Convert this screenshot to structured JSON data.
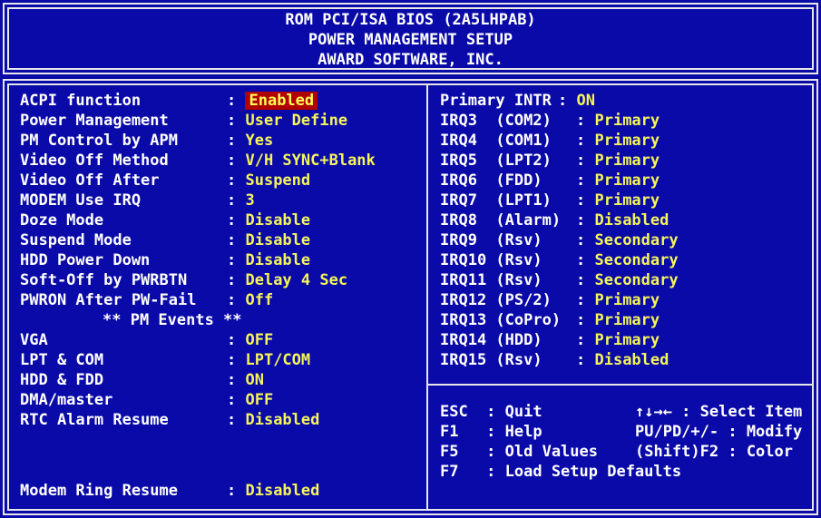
{
  "header": {
    "line1": "ROM PCI/ISA BIOS (2A5LHPAB)",
    "line2": "POWER MANAGEMENT SETUP",
    "line3": "AWARD SOFTWARE, INC."
  },
  "left": [
    {
      "label": "ACPI function",
      "value": "Enabled"
    },
    {
      "label": "Power Management",
      "value": "User Define"
    },
    {
      "label": "PM Control by APM",
      "value": "Yes"
    },
    {
      "label": "Video Off Method",
      "value": "V/H SYNC+Blank"
    },
    {
      "label": "Video Off After",
      "value": "Suspend"
    },
    {
      "label": "MODEM Use IRQ",
      "value": "3"
    },
    {
      "label": "Doze Mode",
      "value": "Disable"
    },
    {
      "label": "Suspend Mode",
      "value": "Disable"
    },
    {
      "label": "HDD Power Down",
      "value": "Disable"
    },
    {
      "label": "Soft-Off by PWRBTN",
      "value": "Delay 4 Sec"
    },
    {
      "label": "PWRON After PW-Fail",
      "value": "Off"
    },
    {
      "label": "VGA",
      "value": "OFF"
    },
    {
      "label": "LPT & COM",
      "value": "LPT/COM"
    },
    {
      "label": "HDD & FDD",
      "value": "ON"
    },
    {
      "label": "DMA/master",
      "value": "OFF"
    },
    {
      "label": "RTC Alarm Resume",
      "value": "Disabled"
    },
    {
      "label": "Modem Ring Resume",
      "value": "Disabled"
    }
  ],
  "pm_events_title": "** PM Events **",
  "right": [
    {
      "label": "Primary INTR",
      "value": "ON"
    },
    {
      "label": "IRQ3  (COM2)",
      "value": "Primary"
    },
    {
      "label": "IRQ4  (COM1)",
      "value": "Primary"
    },
    {
      "label": "IRQ5  (LPT2)",
      "value": "Primary"
    },
    {
      "label": "IRQ6  (FDD)",
      "value": "Primary"
    },
    {
      "label": "IRQ7  (LPT1)",
      "value": "Primary"
    },
    {
      "label": "IRQ8  (Alarm)",
      "value": "Disabled"
    },
    {
      "label": "IRQ9  (Rsv)",
      "value": "Secondary"
    },
    {
      "label": "IRQ10 (Rsv)",
      "value": "Secondary"
    },
    {
      "label": "IRQ11 (Rsv)",
      "value": "Secondary"
    },
    {
      "label": "IRQ12 (PS/2)",
      "value": "Primary"
    },
    {
      "label": "IRQ13 (CoPro)",
      "value": "Primary"
    },
    {
      "label": "IRQ14 (HDD)",
      "value": "Primary"
    },
    {
      "label": "IRQ15 (Rsv)",
      "value": "Disabled"
    }
  ],
  "keys": {
    "esc": "ESC  : Quit",
    "f1": "F1   : Help",
    "f5": "F5   : Old Values",
    "f7": "F7   : Load Setup Defaults",
    "select": "↑↓→← : Select Item",
    "modify": "PU/PD/+/- : Modify",
    "color": "(Shift)F2 : Color"
  },
  "colors": {
    "background": "#0a0aa8",
    "value": "#f5f55a",
    "highlight": "#b00000"
  }
}
